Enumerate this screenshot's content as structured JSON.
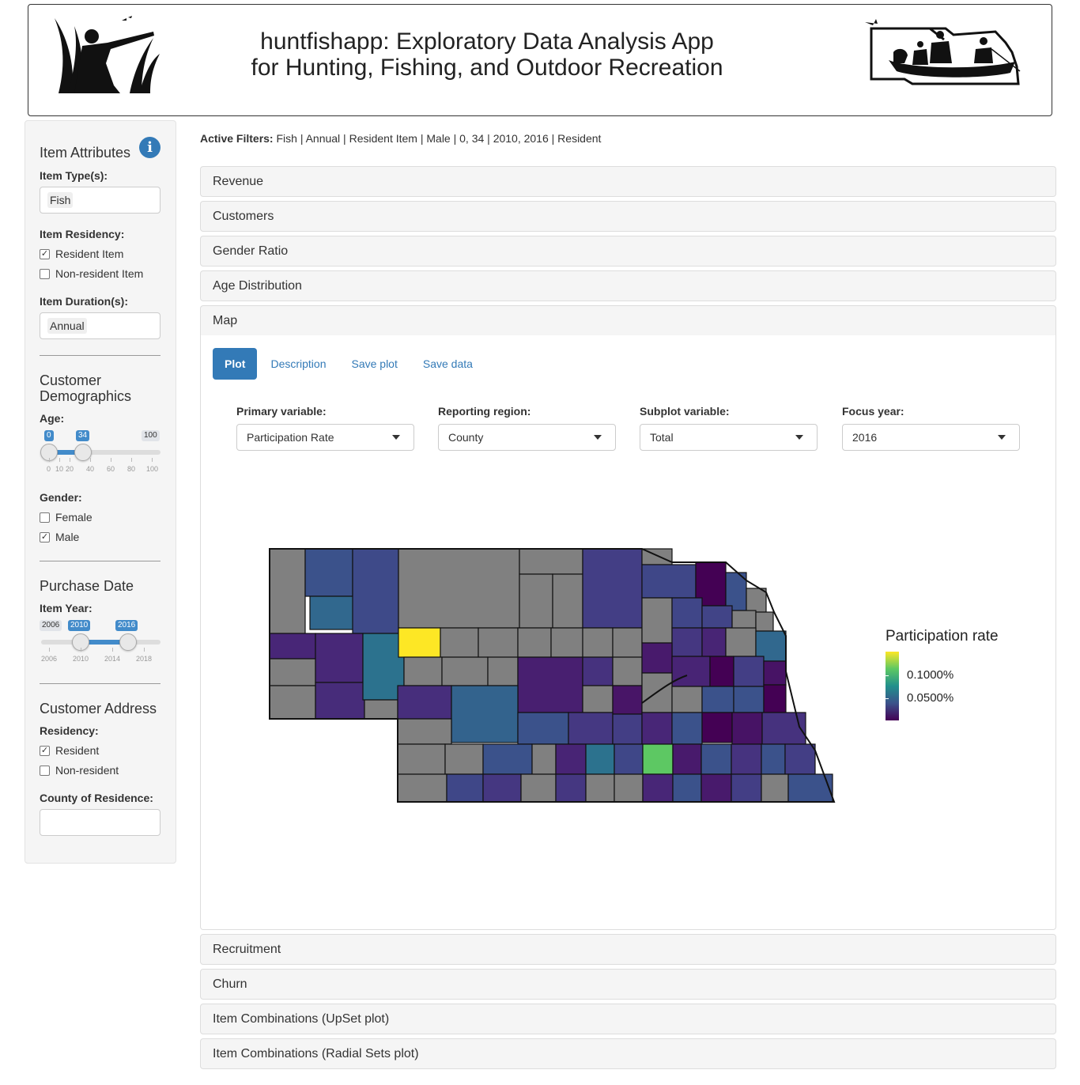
{
  "header": {
    "title_line1": "huntfishapp: Exploratory Data Analysis App",
    "title_line2": "for Hunting, Fishing, and Outdoor Recreation"
  },
  "sidebar": {
    "item_attributes": {
      "title": "Item Attributes",
      "item_types_label": "Item Type(s):",
      "item_types_value": "Fish",
      "residency_label": "Item Residency:",
      "residency_options": [
        {
          "label": "Resident Item",
          "checked": true
        },
        {
          "label": "Non-resident Item",
          "checked": false
        }
      ],
      "duration_label": "Item Duration(s):",
      "duration_value": "Annual"
    },
    "demographics": {
      "title": "Customer Demographics",
      "age_label": "Age:",
      "age_min": "0",
      "age_max": "100",
      "age_from": "0",
      "age_to": "34",
      "age_grid": [
        "0",
        "10",
        "20",
        "40",
        "60",
        "80",
        "100"
      ],
      "gender_label": "Gender:",
      "gender_options": [
        {
          "label": "Female",
          "checked": false
        },
        {
          "label": "Male",
          "checked": true
        }
      ]
    },
    "purchase": {
      "title": "Purchase Date",
      "year_label": "Item Year:",
      "year_min": "2006",
      "year_from": "2010",
      "year_to": "2016",
      "year_grid": [
        "2006",
        "2010",
        "2014",
        "2018"
      ]
    },
    "address": {
      "title": "Customer Address",
      "residency_label": "Residency:",
      "residency_options": [
        {
          "label": "Resident",
          "checked": true
        },
        {
          "label": "Non-resident",
          "checked": false
        }
      ],
      "county_label": "County of Residence:",
      "county_value": ""
    }
  },
  "main": {
    "filters_label": "Active Filters:",
    "filters_value": "Fish | Annual | Resident Item | Male | 0, 34 | 2010, 2016 | Resident",
    "panels_top": [
      "Revenue",
      "Customers",
      "Gender Ratio",
      "Age Distribution",
      "Map"
    ],
    "panels_bottom": [
      "Recruitment",
      "Churn",
      "Item Combinations (UpSet plot)",
      "Item Combinations (Radial Sets plot)"
    ],
    "tabs": [
      "Plot",
      "Description",
      "Save plot",
      "Save data"
    ],
    "controls": [
      {
        "label": "Primary variable:",
        "value": "Participation Rate"
      },
      {
        "label": "Reporting region:",
        "value": "County"
      },
      {
        "label": "Subplot variable:",
        "value": "Total"
      },
      {
        "label": "Focus year:",
        "value": "2016"
      }
    ],
    "legend": {
      "title": "Participation rate",
      "labels": [
        "0.1000%",
        "0.0500%"
      ]
    }
  },
  "colors": {
    "primary": "#337ab7",
    "slider": "#428bca",
    "map_na": "#808080",
    "viridis": [
      "#440154",
      "#3b528b",
      "#21908c",
      "#5dc863",
      "#fde725"
    ]
  }
}
